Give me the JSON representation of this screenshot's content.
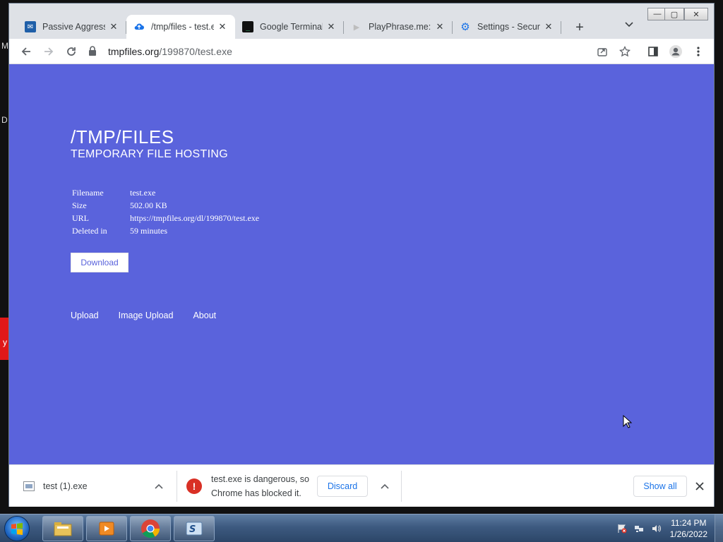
{
  "desktop": {
    "fragments": [
      "M",
      "D",
      "y"
    ]
  },
  "window_controls": {
    "minimize": "—",
    "maximize": "▢",
    "close": "✕"
  },
  "tabs": [
    {
      "title": "Passive Aggressive",
      "favicon": "email-icon",
      "favicon_color": "#1f5fa8"
    },
    {
      "title": "/tmp/files - test.exe",
      "favicon": "upload-cloud-icon",
      "favicon_color": "#1a73e8",
      "active": true
    },
    {
      "title": "Google Terminal",
      "favicon": "terminal-icon",
      "favicon_color": "#111111"
    },
    {
      "title": "PlayPhrase.me: S",
      "favicon": "play-icon",
      "favicon_color": "#cfcfcf"
    },
    {
      "title": "Settings - Security",
      "favicon": "settings-gear-icon",
      "favicon_color": "#1a73e8"
    }
  ],
  "tab_close_glyph": "✕",
  "new_tab_glyph": "+",
  "toolbar": {
    "url_host": "tmpfiles.org",
    "url_path": "/199870/test.exe"
  },
  "page": {
    "title": "/TMP/FILES",
    "subtitle": "TEMPORARY FILE HOSTING",
    "fields": [
      {
        "label": "Filename",
        "value": "test.exe"
      },
      {
        "label": "Size",
        "value": "502.00 KB"
      },
      {
        "label": "URL",
        "value": "https://tmpfiles.org/dl/199870/test.exe"
      },
      {
        "label": "Deleted in",
        "value": "59 minutes"
      }
    ],
    "download_label": "Download",
    "footer_links": [
      "Upload",
      "Image Upload",
      "About"
    ],
    "background_color": "#5a63dc"
  },
  "downloads": {
    "item1_name": "test (1).exe",
    "item2_line1": "test.exe is dangerous, so",
    "item2_line2": "Chrome has blocked it.",
    "discard_label": "Discard",
    "show_all_label": "Show all"
  },
  "taskbar": {
    "time": "11:24 PM",
    "date": "1/26/2022",
    "apps": [
      "file-explorer-icon",
      "media-player-icon",
      "chrome-icon",
      "terminal-app-icon"
    ]
  }
}
